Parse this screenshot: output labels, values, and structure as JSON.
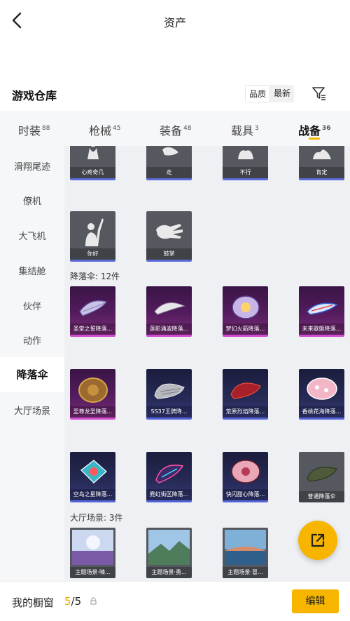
{
  "header": {
    "title": "资产"
  },
  "warehouse": {
    "title": "游戏仓库",
    "sort_options": [
      "品质",
      "最新"
    ]
  },
  "tabs": [
    {
      "label": "时装",
      "count": "88"
    },
    {
      "label": "枪械",
      "count": "45"
    },
    {
      "label": "装备",
      "count": "48"
    },
    {
      "label": "载具",
      "count": "3"
    },
    {
      "label": "战备",
      "count": "36"
    }
  ],
  "sidebar": {
    "items": [
      "滑翔尾迹",
      "僚机",
      "大飞机",
      "集结舱",
      "伙伴",
      "动作",
      "降落伞",
      "大厅场景"
    ]
  },
  "actions": {
    "row1": [
      "心疼奇几",
      "走",
      "不行",
      "肯定"
    ],
    "row2": [
      "你好",
      "鼓掌"
    ]
  },
  "parachutes": {
    "title": "降落伞: 12件",
    "items": [
      "圣堂之誓降落...",
      "莲影涌波降落...",
      "梦幻火箭降落...",
      "未来歌姬降落...",
      "至尊龙圣降落...",
      "SS37王牌降...",
      "荒原烈焰降落...",
      "香桃花海降落...",
      "空岛之星降落...",
      "霓虹街区降落...",
      "快闪甜心降落...",
      "普通降落伞"
    ]
  },
  "scenes": {
    "title": "大厅场景: 3件",
    "items": [
      "主题场景·晴...",
      "主题场景·勇...",
      "主题场景·冒..."
    ]
  },
  "showcase": {
    "label": "我的橱窗",
    "current": "5",
    "total": "/5",
    "edit_label": "编辑"
  },
  "colors": {
    "accent": "#f7b500",
    "rare_purple": "#d14bd1",
    "rare_blue": "#5563d9"
  }
}
